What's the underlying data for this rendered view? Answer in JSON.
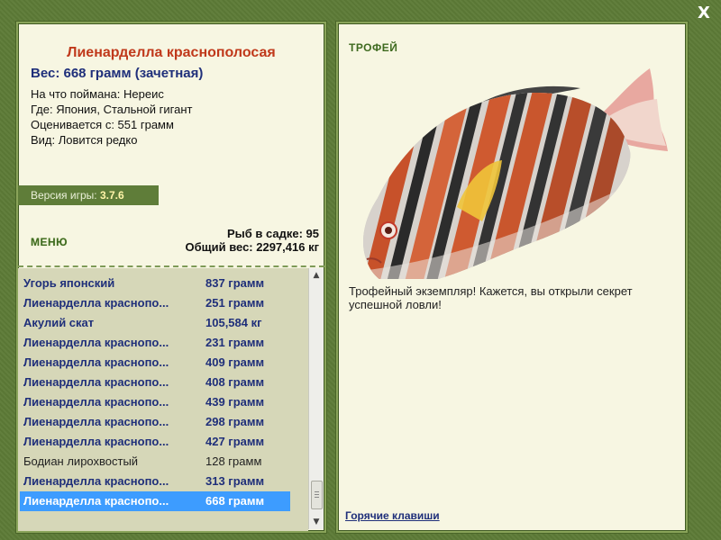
{
  "window": {
    "close_label": "X"
  },
  "fish": {
    "title": "Лиенарделла краснополосая",
    "weight": "Вес: 668 грамм (зачетная)",
    "info": [
      "На что поймана: Нереис",
      "Где: Япония, Стальной гигант",
      "Оценивается с: 551 грамм",
      "Вид: Ловится редко"
    ]
  },
  "version": {
    "label": "Версия игры:",
    "value": "3.7.6"
  },
  "menu": {
    "label": "МЕНЮ"
  },
  "stats": {
    "count": "Рыб в садке: 95",
    "total": "Общий вес: 2297,416 кг"
  },
  "catch_list": [
    {
      "name": "Угорь японский",
      "weight": "837 грамм",
      "style": "bold"
    },
    {
      "name": "Лиенарделла краснопо...",
      "weight": "251 грамм",
      "style": "bold"
    },
    {
      "name": "Акулий скат",
      "weight": "105,584 кг",
      "style": "bold"
    },
    {
      "name": "Лиенарделла краснопо...",
      "weight": "231 грамм",
      "style": "bold"
    },
    {
      "name": "Лиенарделла краснопо...",
      "weight": "409 грамм",
      "style": "bold"
    },
    {
      "name": "Лиенарделла краснопо...",
      "weight": "408 грамм",
      "style": "bold"
    },
    {
      "name": "Лиенарделла краснопо...",
      "weight": "439 грамм",
      "style": "bold"
    },
    {
      "name": "Лиенарделла краснопо...",
      "weight": "298 грамм",
      "style": "bold"
    },
    {
      "name": "Лиенарделла краснопо...",
      "weight": "427 грамм",
      "style": "bold"
    },
    {
      "name": "Бодиан лирохвостый",
      "weight": "128 грамм",
      "style": "normal"
    },
    {
      "name": "Лиенарделла краснопо...",
      "weight": "313 грамм",
      "style": "bold"
    },
    {
      "name": "Лиенарделла краснопо...",
      "weight": "668 грамм",
      "style": "selected"
    }
  ],
  "trophy": {
    "label": "ТРОФЕЙ",
    "text": "Трофейный экземпляр! Кажется, вы открыли секрет успешной ловли!"
  },
  "hotkeys": {
    "label": "Горячие клавиши"
  },
  "colors": {
    "frame": "#5d7b37",
    "panel": "#f7f6e2",
    "title_red": "#c0391b",
    "link_blue": "#1f2f7a",
    "selection": "#3d9cff"
  }
}
